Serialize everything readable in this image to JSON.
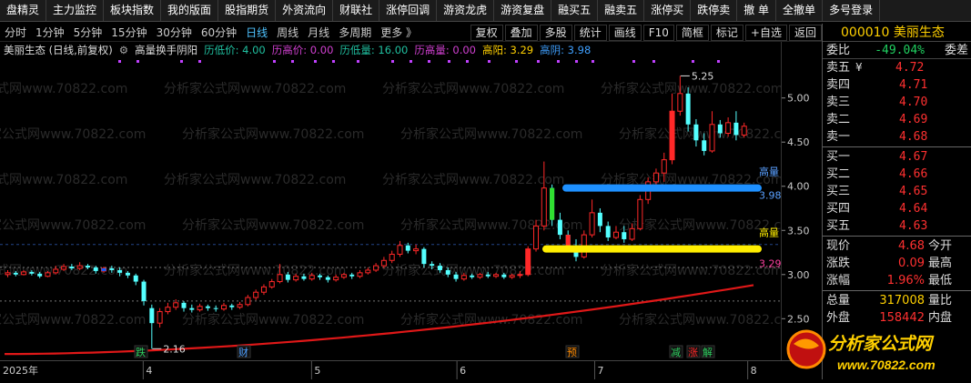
{
  "topbar": [
    "盘精灵",
    "主力监控",
    "板块指数",
    "我的版面",
    "股指期货",
    "外资流向",
    "财联社",
    "涨停回调",
    "游资龙虎",
    "游资复盘",
    "融买五",
    "融卖五",
    "涨停买",
    "跌停卖",
    "撤 单",
    "全撤单",
    "多号登录"
  ],
  "timeframes": [
    "分时",
    "1分钟",
    "5分钟",
    "15分钟",
    "30分钟",
    "60分钟",
    "日线",
    "周线",
    "月线",
    "多周期",
    "更多 》"
  ],
  "active_timeframe": "日线",
  "tools": [
    "复权",
    "叠加",
    "多股",
    "统计",
    "画线",
    "F10",
    "简框",
    "标记",
    "+自选",
    "返回"
  ],
  "indicator": {
    "title": "美丽生态 (日线,前复权)",
    "name": "高量换手阴阳",
    "items": [
      {
        "text": "历低价: 4.00",
        "color": "#20c0a0"
      },
      {
        "text": "历高价: 0.00",
        "color": "#d040d0"
      },
      {
        "text": "历低量: 16.00",
        "color": "#20c0a0"
      },
      {
        "text": "历高量: 0.00",
        "color": "#d040d0"
      },
      {
        "text": "高阳: 3.29",
        "color": "#ffd000"
      },
      {
        "text": "高阴: 3.98",
        "color": "#3fa0ff"
      }
    ]
  },
  "stock": {
    "code": "000010",
    "name": "美丽生态"
  },
  "weibi": {
    "label": "委比",
    "value": "-49.04%",
    "right": "委差"
  },
  "sells": [
    {
      "label": "卖五",
      "mark": "¥",
      "price": "4.72"
    },
    {
      "label": "卖四",
      "price": "4.71"
    },
    {
      "label": "卖三",
      "price": "4.70"
    },
    {
      "label": "卖二",
      "price": "4.69"
    },
    {
      "label": "卖一",
      "price": "4.68"
    }
  ],
  "buys": [
    {
      "label": "买一",
      "price": "4.67"
    },
    {
      "label": "买二",
      "price": "4.66"
    },
    {
      "label": "买三",
      "price": "4.65"
    },
    {
      "label": "买四",
      "price": "4.64"
    },
    {
      "label": "买五",
      "price": "4.63"
    }
  ],
  "stats1": [
    {
      "l1": "现价",
      "v1": "4.68",
      "c1": "#ff3030",
      "l2": "今开"
    },
    {
      "l1": "涨跌",
      "v1": "0.09",
      "c1": "#ff3030",
      "l2": "最高"
    },
    {
      "l1": "涨幅",
      "v1": "1.96%",
      "c1": "#ff3030",
      "l2": "最低"
    }
  ],
  "stats2": [
    {
      "l1": "总量",
      "v1": "317008",
      "c1": "#ffd000",
      "l2": "量比"
    },
    {
      "l1": "外盘",
      "v1": "158442",
      "c1": "#ff3030",
      "l2": "内盘"
    }
  ],
  "yaxis_ticks": [
    "5.00",
    "4.50",
    "4.00",
    "3.50",
    "3.00",
    "2.50"
  ],
  "xaxis": {
    "year": "2025年",
    "months": [
      "4",
      "5",
      "6",
      "7",
      "8"
    ]
  },
  "annotations": {
    "high_label": "5.25",
    "low_label": "2.16",
    "blue_label": "高量",
    "blue_val": "3.980",
    "yellow_label": "高量",
    "yellow_val": "3.290"
  },
  "events": [
    "跌",
    "财",
    "预",
    "减",
    "涨",
    "解"
  ],
  "watermark": "分析家公式网www.70822.com",
  "logo": {
    "text": "分析家公式网",
    "url": "www.70822.com"
  },
  "chart_data": {
    "type": "candlestick",
    "ylim": [
      2.05,
      5.45
    ],
    "candles": [
      [
        3.0,
        3.02,
        2.97,
        3.05
      ],
      [
        3.02,
        3.0,
        2.98,
        3.04
      ],
      [
        3.0,
        3.03,
        2.99,
        3.05
      ],
      [
        3.03,
        3.01,
        2.99,
        3.05
      ],
      [
        3.01,
        2.98,
        2.96,
        3.03
      ],
      [
        2.98,
        3.02,
        2.97,
        3.04
      ],
      [
        3.02,
        3.06,
        3.0,
        3.1
      ],
      [
        3.06,
        3.09,
        3.04,
        3.12
      ],
      [
        3.09,
        3.07,
        3.05,
        3.12
      ],
      [
        3.07,
        3.1,
        3.05,
        3.14
      ],
      [
        3.1,
        3.08,
        3.06,
        3.12
      ],
      [
        3.08,
        3.04,
        3.01,
        3.1
      ],
      [
        3.04,
        3.07,
        3.02,
        3.09
      ],
      [
        3.07,
        3.05,
        3.02,
        3.1
      ],
      [
        3.05,
        3.02,
        2.98,
        3.08
      ],
      [
        3.02,
        2.99,
        2.96,
        3.04
      ],
      [
        2.99,
        2.92,
        2.88,
        3.01
      ],
      [
        2.92,
        2.7,
        2.65,
        2.94
      ],
      [
        2.62,
        2.45,
        2.16,
        2.66
      ],
      [
        2.45,
        2.58,
        2.4,
        2.62
      ],
      [
        2.58,
        2.63,
        2.55,
        2.68
      ],
      [
        2.63,
        2.68,
        2.6,
        2.72
      ],
      [
        2.68,
        2.62,
        2.58,
        2.7
      ],
      [
        2.62,
        2.6,
        2.57,
        2.66
      ],
      [
        2.6,
        2.64,
        2.58,
        2.67
      ],
      [
        2.64,
        2.62,
        2.59,
        2.66
      ],
      [
        2.62,
        2.61,
        2.58,
        2.65
      ],
      [
        2.61,
        2.65,
        2.59,
        2.68
      ],
      [
        2.65,
        2.63,
        2.6,
        2.67
      ],
      [
        2.63,
        2.66,
        2.61,
        2.69
      ],
      [
        2.66,
        2.74,
        2.64,
        2.77
      ],
      [
        2.74,
        2.8,
        2.71,
        2.83
      ],
      [
        2.8,
        2.86,
        2.77,
        2.89
      ],
      [
        2.86,
        2.92,
        2.84,
        2.95
      ],
      [
        2.92,
        3.0,
        2.9,
        3.12
      ],
      [
        3.0,
        2.94,
        2.91,
        3.03
      ],
      [
        2.94,
        2.98,
        2.92,
        3.01
      ],
      [
        2.98,
        2.95,
        2.93,
        3.01
      ],
      [
        2.95,
        2.99,
        2.93,
        3.02
      ],
      [
        2.99,
        2.97,
        2.94,
        3.01
      ],
      [
        2.97,
        2.94,
        2.91,
        2.99
      ],
      [
        2.94,
        2.97,
        2.92,
        3.0
      ],
      [
        2.97,
        3.0,
        2.95,
        3.02
      ],
      [
        3.0,
        2.98,
        2.95,
        3.02
      ],
      [
        2.98,
        3.02,
        2.96,
        3.05
      ],
      [
        3.02,
        3.05,
        3.0,
        3.08
      ],
      [
        3.05,
        3.1,
        3.03,
        3.13
      ],
      [
        3.1,
        3.16,
        3.07,
        3.2
      ],
      [
        3.16,
        3.23,
        3.13,
        3.27
      ],
      [
        3.23,
        3.33,
        3.2,
        3.38
      ],
      [
        3.33,
        3.27,
        3.24,
        3.36
      ],
      [
        3.27,
        3.29,
        3.23,
        3.34
      ],
      [
        3.29,
        3.12,
        3.08,
        3.31
      ],
      [
        3.12,
        3.1,
        3.06,
        3.15
      ],
      [
        3.1,
        3.05,
        3.02,
        3.13
      ],
      [
        3.05,
        3.0,
        2.97,
        3.08
      ],
      [
        3.0,
        2.95,
        2.92,
        3.03
      ],
      [
        2.95,
        2.99,
        2.93,
        3.02
      ],
      [
        2.99,
        2.97,
        2.95,
        3.01
      ],
      [
        2.97,
        3.0,
        2.95,
        3.02
      ],
      [
        3.0,
        2.98,
        2.96,
        3.03
      ],
      [
        2.98,
        3.0,
        2.96,
        3.02
      ],
      [
        3.0,
        2.97,
        2.95,
        3.02
      ],
      [
        2.97,
        2.99,
        2.95,
        3.01
      ],
      [
        2.99,
        3.0,
        2.96,
        3.04
      ],
      [
        3.0,
        3.29,
        2.98,
        3.32
      ],
      [
        3.29,
        3.55,
        3.26,
        3.62
      ],
      [
        3.55,
        3.98,
        3.5,
        4.28
      ],
      [
        3.98,
        3.62,
        3.55,
        4.02
      ],
      [
        3.62,
        3.45,
        3.4,
        3.7
      ],
      [
        3.45,
        3.3,
        3.28,
        3.5
      ],
      [
        3.3,
        3.2,
        3.15,
        3.4
      ],
      [
        3.2,
        3.45,
        3.18,
        3.5
      ],
      [
        3.45,
        3.7,
        3.42,
        3.85
      ],
      [
        3.7,
        3.55,
        3.48,
        3.75
      ],
      [
        3.55,
        3.42,
        3.38,
        3.6
      ],
      [
        3.42,
        3.48,
        3.4,
        3.55
      ],
      [
        3.48,
        3.4,
        3.36,
        3.55
      ],
      [
        3.4,
        3.52,
        3.38,
        3.58
      ],
      [
        3.52,
        3.85,
        3.5,
        3.9
      ],
      [
        3.85,
        4.05,
        3.8,
        4.1
      ],
      [
        4.05,
        4.15,
        3.98,
        4.2
      ],
      [
        4.15,
        4.3,
        4.05,
        4.38
      ],
      [
        4.3,
        4.85,
        4.25,
        5.05
      ],
      [
        4.85,
        5.05,
        4.8,
        5.25
      ],
      [
        5.05,
        4.7,
        4.62,
        5.12
      ],
      [
        4.7,
        4.52,
        4.45,
        4.76
      ],
      [
        4.52,
        4.4,
        4.35,
        4.6
      ],
      [
        4.4,
        4.7,
        4.38,
        4.85
      ],
      [
        4.7,
        4.6,
        4.55,
        4.75
      ],
      [
        4.6,
        4.72,
        4.56,
        4.78
      ],
      [
        4.72,
        4.58,
        4.52,
        4.85
      ],
      [
        4.58,
        4.68,
        4.55,
        4.72
      ]
    ],
    "ma": [
      2.0,
      2.1,
      2.2,
      2.4,
      2.55,
      2.7,
      2.85
    ]
  }
}
